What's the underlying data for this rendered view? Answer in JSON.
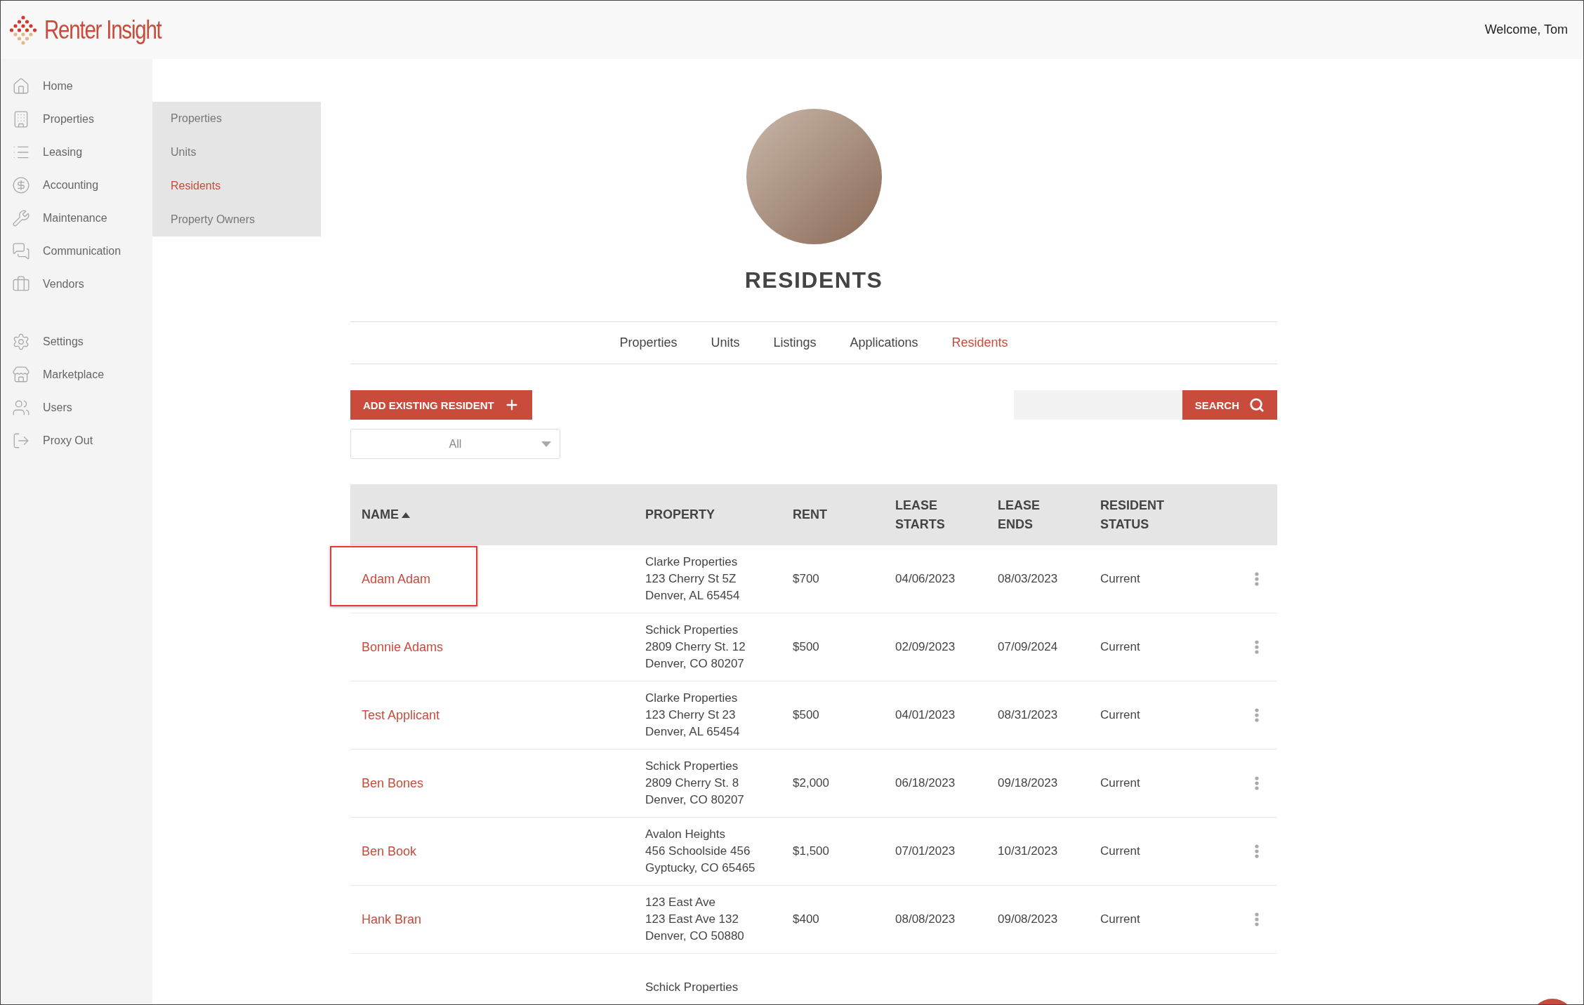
{
  "header": {
    "logo": "Renter Insight",
    "welcome": "Welcome, Tom"
  },
  "sidebar": {
    "groups": [
      [
        {
          "label": "Home"
        },
        {
          "label": "Properties"
        },
        {
          "label": "Leasing"
        },
        {
          "label": "Accounting"
        },
        {
          "label": "Maintenance"
        },
        {
          "label": "Communication"
        },
        {
          "label": "Vendors"
        }
      ],
      [
        {
          "label": "Settings"
        },
        {
          "label": "Marketplace"
        },
        {
          "label": "Users"
        },
        {
          "label": "Proxy Out"
        }
      ]
    ]
  },
  "submenu": {
    "items": [
      {
        "label": "Properties",
        "selected": false
      },
      {
        "label": "Units",
        "selected": false
      },
      {
        "label": "Residents",
        "selected": true
      },
      {
        "label": "Property Owners",
        "selected": false
      }
    ]
  },
  "page": {
    "title": "RESIDENTS",
    "tabs": [
      {
        "label": "Properties",
        "selected": false
      },
      {
        "label": "Units",
        "selected": false
      },
      {
        "label": "Listings",
        "selected": false
      },
      {
        "label": "Applications",
        "selected": false
      },
      {
        "label": "Residents",
        "selected": true
      }
    ]
  },
  "actions": {
    "add_button": "ADD EXISTING RESIDENT",
    "search_button": "SEARCH",
    "filter": {
      "value": "All"
    }
  },
  "table": {
    "columns": [
      {
        "label": "NAME",
        "sorted": true
      },
      {
        "label": "PROPERTY",
        "sorted": false
      },
      {
        "label": "RENT",
        "sorted": false
      },
      {
        "label": "LEASE STARTS",
        "sorted": false
      },
      {
        "label": "LEASE ENDS",
        "sorted": false
      },
      {
        "label": "RESIDENT STATUS",
        "sorted": false
      }
    ],
    "rows": [
      {
        "name": "Adam Adam",
        "property": [
          "Clarke Properties",
          "123 Cherry St 5Z",
          "Denver, AL 65454"
        ],
        "rent": "$700",
        "lease_starts": "04/06/2023",
        "lease_ends": "08/03/2023",
        "status": "Current",
        "highlighted": true
      },
      {
        "name": "Bonnie Adams",
        "property": [
          "Schick Properties",
          "2809 Cherry St. 12",
          "Denver, CO 80207"
        ],
        "rent": "$500",
        "lease_starts": "02/09/2023",
        "lease_ends": "07/09/2024",
        "status": "Current",
        "highlighted": false
      },
      {
        "name": "Test Applicant",
        "property": [
          "Clarke Properties",
          "123 Cherry St 23",
          "Denver, AL 65454"
        ],
        "rent": "$500",
        "lease_starts": "04/01/2023",
        "lease_ends": "08/31/2023",
        "status": "Current",
        "highlighted": false
      },
      {
        "name": "Ben Bones",
        "property": [
          "Schick Properties",
          "2809 Cherry St. 8",
          "Denver, CO 80207"
        ],
        "rent": "$2,000",
        "lease_starts": "06/18/2023",
        "lease_ends": "09/18/2023",
        "status": "Current",
        "highlighted": false
      },
      {
        "name": "Ben Book",
        "property": [
          "Avalon Heights",
          "456 Schoolside 456",
          "Gyptucky, CO 65465"
        ],
        "rent": "$1,500",
        "lease_starts": "07/01/2023",
        "lease_ends": "10/31/2023",
        "status": "Current",
        "highlighted": false
      },
      {
        "name": "Hank Bran",
        "property": [
          "123 East Ave",
          "123 East Ave 132",
          "Denver, CO 50880"
        ],
        "rent": "$400",
        "lease_starts": "08/08/2023",
        "lease_ends": "09/08/2023",
        "status": "Current",
        "highlighted": false
      },
      {
        "property": [
          "Schick Properties"
        ],
        "highlighted": false
      }
    ]
  }
}
